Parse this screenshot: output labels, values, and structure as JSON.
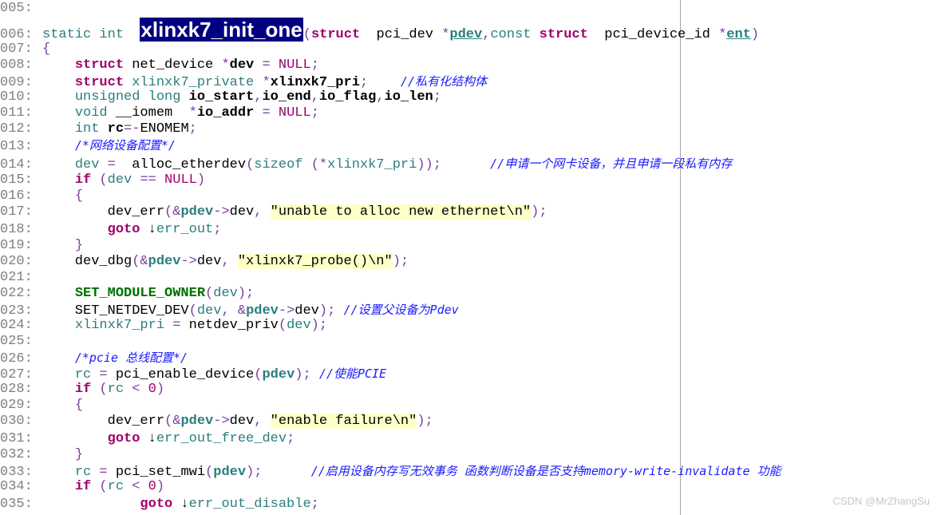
{
  "lines": [
    {
      "n": "005:",
      "tokens": []
    },
    {
      "n": "006:",
      "tokens": [
        [
          "kw",
          "static int  "
        ],
        [
          "hl",
          "xlinxk7_init_one"
        ],
        [
          "p",
          "("
        ],
        [
          "ty",
          "struct"
        ],
        [
          "",
          "  pci_dev "
        ],
        [
          "p",
          "*"
        ],
        [
          "bu",
          "pdev"
        ],
        [
          "p",
          ","
        ],
        [
          "kw",
          "const "
        ],
        [
          "ty",
          "struct"
        ],
        [
          "",
          "  pci_device_id "
        ],
        [
          "p",
          "*"
        ],
        [
          "bu",
          "ent"
        ],
        [
          "p",
          ")"
        ]
      ]
    },
    {
      "n": "007:",
      "tokens": [
        [
          "p",
          "{"
        ]
      ]
    },
    {
      "n": "008:",
      "tokens": [
        [
          "",
          "    "
        ],
        [
          "ty",
          "struct"
        ],
        [
          "",
          " net_device "
        ],
        [
          "p",
          "*"
        ],
        [
          "b",
          "dev"
        ],
        [
          "",
          " "
        ],
        [
          "p",
          "="
        ],
        [
          "",
          " "
        ],
        [
          "nm",
          "NULL"
        ],
        [
          "p",
          ";"
        ]
      ]
    },
    {
      "n": "009:",
      "tokens": [
        [
          "",
          "    "
        ],
        [
          "ty",
          "struct"
        ],
        [
          "gr",
          " xlinxk7_private "
        ],
        [
          "p",
          "*"
        ],
        [
          "b",
          "xlinxk7_pri"
        ],
        [
          "p",
          ";"
        ],
        [
          "",
          "    "
        ],
        [
          "cm",
          "//私有化结构体"
        ]
      ]
    },
    {
      "n": "010:",
      "tokens": [
        [
          "",
          "    "
        ],
        [
          "kw",
          "unsigned long "
        ],
        [
          "b",
          "io_start"
        ],
        [
          "p",
          ","
        ],
        [
          "b",
          "io_end"
        ],
        [
          "p",
          ","
        ],
        [
          "b",
          "io_flag"
        ],
        [
          "p",
          ","
        ],
        [
          "b",
          "io_len"
        ],
        [
          "p",
          ";"
        ]
      ]
    },
    {
      "n": "011:",
      "tokens": [
        [
          "",
          "    "
        ],
        [
          "kw",
          "void"
        ],
        [
          "",
          " __iomem  "
        ],
        [
          "p",
          "*"
        ],
        [
          "b",
          "io_addr"
        ],
        [
          "",
          " "
        ],
        [
          "p",
          "="
        ],
        [
          "",
          " "
        ],
        [
          "nm",
          "NULL"
        ],
        [
          "p",
          ";"
        ]
      ]
    },
    {
      "n": "012:",
      "tokens": [
        [
          "",
          "    "
        ],
        [
          "kw",
          "int "
        ],
        [
          "b",
          "rc"
        ],
        [
          "p",
          "=-"
        ],
        [
          "",
          "ENOMEM"
        ],
        [
          "p",
          ";"
        ]
      ]
    },
    {
      "n": "013:",
      "tokens": [
        [
          "",
          "    "
        ],
        [
          "cm",
          "/*网络设备配置*/"
        ]
      ]
    },
    {
      "n": "014:",
      "tokens": [
        [
          "",
          "    "
        ],
        [
          "gr",
          "dev"
        ],
        [
          "",
          " "
        ],
        [
          "p",
          "="
        ],
        [
          "",
          "  alloc_etherdev"
        ],
        [
          "p",
          "("
        ],
        [
          "gr",
          "sizeof "
        ],
        [
          "p",
          "(*"
        ],
        [
          "gr",
          "xlinxk7_pri"
        ],
        [
          "p",
          "));"
        ],
        [
          "",
          "      "
        ],
        [
          "cm",
          "//申请一个网卡设备，并且申请一段私有内存"
        ]
      ]
    },
    {
      "n": "015:",
      "tokens": [
        [
          "",
          "    "
        ],
        [
          "kwb",
          "if"
        ],
        [
          "",
          " "
        ],
        [
          "p",
          "("
        ],
        [
          "gr",
          "dev"
        ],
        [
          "",
          " "
        ],
        [
          "p",
          "=="
        ],
        [
          "",
          " "
        ],
        [
          "nm",
          "NULL"
        ],
        [
          "p",
          ")"
        ]
      ]
    },
    {
      "n": "016:",
      "tokens": [
        [
          "",
          "    "
        ],
        [
          "p",
          "{"
        ]
      ]
    },
    {
      "n": "017:",
      "tokens": [
        [
          "",
          "        dev_err"
        ],
        [
          "p",
          "(&"
        ],
        [
          "bt",
          "pdev"
        ],
        [
          "p",
          "->"
        ],
        [
          "",
          "dev"
        ],
        [
          "p",
          ","
        ],
        [
          "",
          " "
        ],
        [
          "st",
          "\"unable to alloc new ethernet\\n\""
        ],
        [
          "p",
          ");"
        ]
      ]
    },
    {
      "n": "018:",
      "tokens": [
        [
          "",
          "        "
        ],
        [
          "kwb",
          "goto"
        ],
        [
          "",
          " ↓"
        ],
        [
          "gr",
          "err_out"
        ],
        [
          "p",
          ";"
        ]
      ]
    },
    {
      "n": "019:",
      "tokens": [
        [
          "",
          "    "
        ],
        [
          "p",
          "}"
        ]
      ]
    },
    {
      "n": "020:",
      "tokens": [
        [
          "",
          "    dev_dbg"
        ],
        [
          "p",
          "(&"
        ],
        [
          "bt",
          "pdev"
        ],
        [
          "p",
          "->"
        ],
        [
          "",
          "dev"
        ],
        [
          "p",
          ","
        ],
        [
          "",
          " "
        ],
        [
          "st",
          "\"xlinxk7_probe()\\n\""
        ],
        [
          "p",
          ");"
        ]
      ]
    },
    {
      "n": "021:",
      "tokens": []
    },
    {
      "n": "022:",
      "tokens": [
        [
          "",
          "    "
        ],
        [
          "mac",
          "SET_MODULE_OWNER"
        ],
        [
          "p",
          "("
        ],
        [
          "gr",
          "dev"
        ],
        [
          "p",
          ");"
        ]
      ]
    },
    {
      "n": "023:",
      "tokens": [
        [
          "",
          "    SET_NETDEV_DEV"
        ],
        [
          "p",
          "("
        ],
        [
          "gr",
          "dev"
        ],
        [
          "p",
          ","
        ],
        [
          "",
          " "
        ],
        [
          "p",
          "&"
        ],
        [
          "bt",
          "pdev"
        ],
        [
          "p",
          "->"
        ],
        [
          "",
          "dev"
        ],
        [
          "p",
          ");"
        ],
        [
          "",
          " "
        ],
        [
          "cm",
          "//设置父设备为Pdev"
        ]
      ]
    },
    {
      "n": "024:",
      "tokens": [
        [
          "",
          "    "
        ],
        [
          "gr",
          "xlinxk7_pri"
        ],
        [
          "",
          " "
        ],
        [
          "p",
          "="
        ],
        [
          "",
          " netdev_priv"
        ],
        [
          "p",
          "("
        ],
        [
          "gr",
          "dev"
        ],
        [
          "p",
          ");"
        ]
      ]
    },
    {
      "n": "025:",
      "tokens": []
    },
    {
      "n": "026:",
      "tokens": [
        [
          "",
          "    "
        ],
        [
          "cm",
          "/*pcie 总线配置*/"
        ]
      ]
    },
    {
      "n": "027:",
      "tokens": [
        [
          "",
          "    "
        ],
        [
          "gr",
          "rc"
        ],
        [
          "",
          " "
        ],
        [
          "p",
          "="
        ],
        [
          "",
          " pci_enable_device"
        ],
        [
          "p",
          "("
        ],
        [
          "bt",
          "pdev"
        ],
        [
          "p",
          ");"
        ],
        [
          "",
          " "
        ],
        [
          "cm",
          "//使能PCIE"
        ]
      ]
    },
    {
      "n": "028:",
      "tokens": [
        [
          "",
          "    "
        ],
        [
          "kwb",
          "if"
        ],
        [
          "",
          " "
        ],
        [
          "p",
          "("
        ],
        [
          "gr",
          "rc"
        ],
        [
          "",
          " "
        ],
        [
          "p",
          "<"
        ],
        [
          "",
          " "
        ],
        [
          "nm",
          "0"
        ],
        [
          "p",
          ")"
        ]
      ]
    },
    {
      "n": "029:",
      "tokens": [
        [
          "",
          "    "
        ],
        [
          "p",
          "{"
        ]
      ]
    },
    {
      "n": "030:",
      "tokens": [
        [
          "",
          "        dev_err"
        ],
        [
          "p",
          "(&"
        ],
        [
          "bt",
          "pdev"
        ],
        [
          "p",
          "->"
        ],
        [
          "",
          "dev"
        ],
        [
          "p",
          ","
        ],
        [
          "",
          " "
        ],
        [
          "st",
          "\"enable failure\\n\""
        ],
        [
          "p",
          ");"
        ]
      ]
    },
    {
      "n": "031:",
      "tokens": [
        [
          "",
          "        "
        ],
        [
          "kwb",
          "goto"
        ],
        [
          "",
          " ↓"
        ],
        [
          "gr",
          "err_out_free_dev"
        ],
        [
          "p",
          ";"
        ]
      ]
    },
    {
      "n": "032:",
      "tokens": [
        [
          "",
          "    "
        ],
        [
          "p",
          "}"
        ]
      ]
    },
    {
      "n": "033:",
      "tokens": [
        [
          "",
          "    "
        ],
        [
          "gr",
          "rc"
        ],
        [
          "",
          " "
        ],
        [
          "p",
          "="
        ],
        [
          "",
          " pci_set_mwi"
        ],
        [
          "p",
          "("
        ],
        [
          "bt",
          "pdev"
        ],
        [
          "p",
          ");"
        ],
        [
          "",
          "      "
        ],
        [
          "cm",
          "//启用设备内存写无效事务 函数判断设备是否支持memory-write-invalidate 功能"
        ]
      ]
    },
    {
      "n": "034:",
      "tokens": [
        [
          "",
          "    "
        ],
        [
          "kwb",
          "if"
        ],
        [
          "",
          " "
        ],
        [
          "p",
          "("
        ],
        [
          "gr",
          "rc"
        ],
        [
          "",
          " "
        ],
        [
          "p",
          "<"
        ],
        [
          "",
          " "
        ],
        [
          "nm",
          "0"
        ],
        [
          "p",
          ")"
        ]
      ]
    },
    {
      "n": "035:",
      "tokens": [
        [
          "",
          "            "
        ],
        [
          "kwb",
          "goto"
        ],
        [
          "",
          " ↓"
        ],
        [
          "gr",
          "err_out_disable"
        ],
        [
          "p",
          ";"
        ]
      ]
    }
  ],
  "watermark": "CSDN @MrZhangSu"
}
